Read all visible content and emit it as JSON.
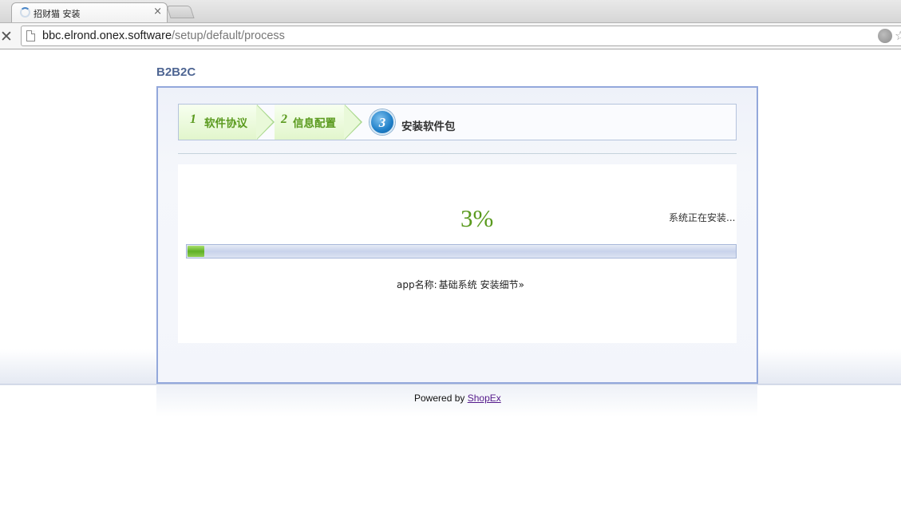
{
  "browser": {
    "tab_title": "招财猫 安装",
    "tab_close": "×",
    "stop_glyph": "✕",
    "url_host": "bbc.elrond.onex.software",
    "url_path": "/setup/default/process",
    "icons": [
      "loading-spinner-icon",
      "page-icon",
      "extension-icon",
      "bookmark-star-icon"
    ]
  },
  "page": {
    "brand": "B2B2C",
    "steps": [
      {
        "number": "1",
        "label": "软件协议",
        "state": "done"
      },
      {
        "number": "2",
        "label": "信息配置",
        "state": "done"
      },
      {
        "number": "3",
        "label": "安装软件包",
        "state": "current"
      }
    ],
    "progress": {
      "percent_text": "3%",
      "percent_value": 3,
      "status_text": "系统正在安装..."
    },
    "detail": {
      "label": "app名称:",
      "app_name": "基础系统",
      "link": "安装细节»"
    },
    "footer": {
      "powered_by": "Powered by",
      "link": "ShopEx"
    },
    "colors": {
      "accent_green": "#5a9a1e",
      "brand_blue": "#4f6693",
      "panel_border": "#93a8db"
    }
  }
}
